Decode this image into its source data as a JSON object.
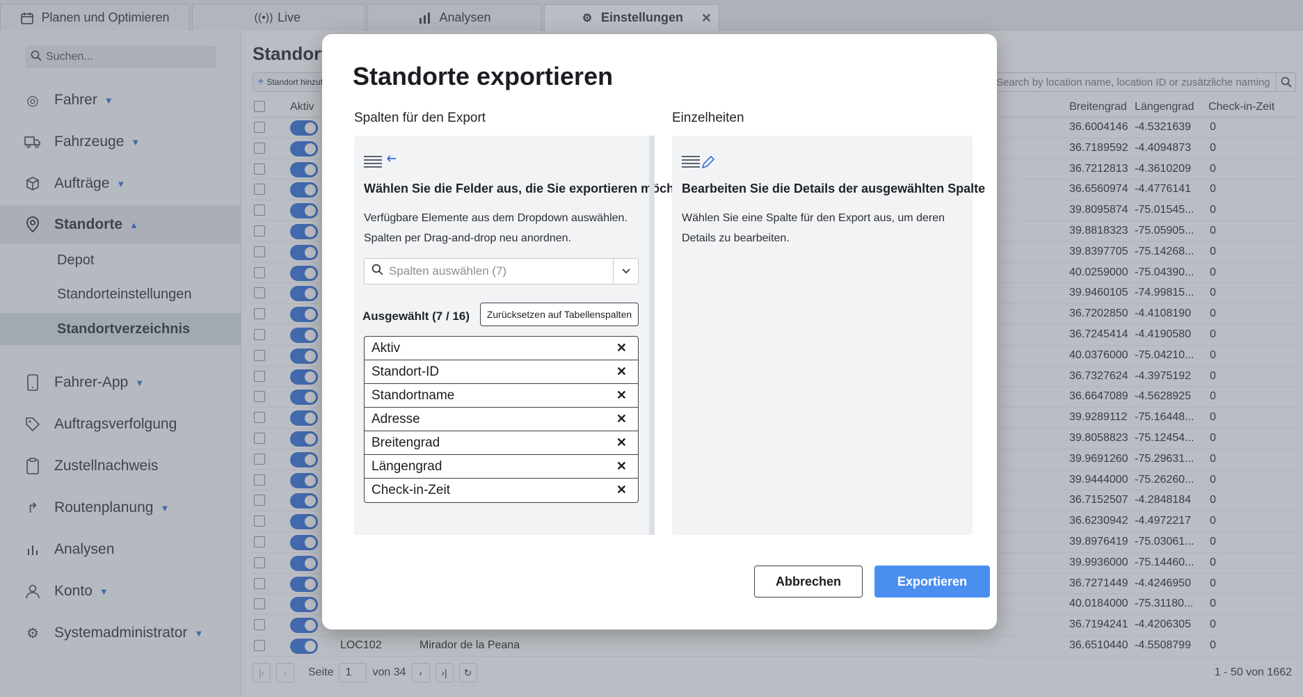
{
  "tabs": [
    {
      "label": "Planen und Optimieren",
      "icon": "calendar-icon"
    },
    {
      "label": "Live",
      "icon": "broadcast-icon"
    },
    {
      "label": "Analysen",
      "icon": "bar-chart-icon"
    },
    {
      "label": "Einstellungen",
      "icon": "gear-icon",
      "active": true
    }
  ],
  "sidebar": {
    "search_placeholder": "Suchen...",
    "items": [
      {
        "label": "Fahrer",
        "icon": "steering-wheel-icon"
      },
      {
        "label": "Fahrzeuge",
        "icon": "truck-icon"
      },
      {
        "label": "Aufträge",
        "icon": "package-icon"
      },
      {
        "label": "Standorte",
        "icon": "location-pin-icon"
      },
      {
        "label": "Fahrer-App",
        "icon": "mobile-icon"
      },
      {
        "label": "Auftragsverfolgung",
        "icon": "tag-icon"
      },
      {
        "label": "Zustellnachweis",
        "icon": "clipboard-icon"
      },
      {
        "label": "Routenplanung",
        "icon": "route-arrow-icon"
      },
      {
        "label": "Analysen",
        "icon": "bar-chart-icon"
      },
      {
        "label": "Konto",
        "icon": "user-icon"
      },
      {
        "label": "Systemadministrator",
        "icon": "gear-icon"
      }
    ],
    "subitems": [
      "Depot",
      "Standorteinstellungen",
      "Standortverzeichnis"
    ]
  },
  "main": {
    "title": "Standort",
    "add_button": "Standort hinzufügen",
    "table_search_placeholder": "Search by location name, location ID or zusätzliche naming",
    "columns": {
      "active": "Aktiv",
      "lat": "Breitengrad",
      "lng": "Längengrad",
      "checkin": "Check-in-Zeit"
    },
    "rows": [
      {
        "lat": "36.6004146",
        "lng": "-4.5321639",
        "checkin": "0"
      },
      {
        "lat": "36.7189592",
        "lng": "-4.4094873",
        "checkin": "0"
      },
      {
        "lat": "36.7212813",
        "lng": "-4.3610209",
        "checkin": "0"
      },
      {
        "lat": "36.6560974",
        "lng": "-4.4776141",
        "checkin": "0"
      },
      {
        "lat": "39.8095874",
        "lng": "-75.01545...",
        "checkin": "0"
      },
      {
        "lat": "39.8818323",
        "lng": "-75.05905...",
        "checkin": "0"
      },
      {
        "lat": "39.8397705",
        "lng": "-75.14268...",
        "checkin": "0"
      },
      {
        "lat": "40.0259000",
        "lng": "-75.04390...",
        "checkin": "0"
      },
      {
        "lat": "39.9460105",
        "lng": "-74.99815...",
        "checkin": "0"
      },
      {
        "lat": "36.7202850",
        "lng": "-4.4108190",
        "checkin": "0"
      },
      {
        "lat": "36.7245414",
        "lng": "-4.4190580",
        "checkin": "0"
      },
      {
        "lat": "40.0376000",
        "lng": "-75.04210...",
        "checkin": "0"
      },
      {
        "lat": "36.7327624",
        "lng": "-4.3975192",
        "checkin": "0"
      },
      {
        "lat": "36.6647089",
        "lng": "-4.5628925",
        "checkin": "0"
      },
      {
        "lat": "39.9289112",
        "lng": "-75.16448...",
        "checkin": "0"
      },
      {
        "lat": "39.8058823",
        "lng": "-75.12454...",
        "checkin": "0"
      },
      {
        "lat": "39.9691260",
        "lng": "-75.29631...",
        "checkin": "0"
      },
      {
        "lat": "39.9444000",
        "lng": "-75.26260...",
        "checkin": "0"
      },
      {
        "lat": "36.7152507",
        "lng": "-4.2848184",
        "checkin": "0"
      },
      {
        "lat": "36.6230942",
        "lng": "-4.4972217",
        "checkin": "0"
      },
      {
        "lat": "39.8976419",
        "lng": "-75.03061...",
        "checkin": "0"
      },
      {
        "lat": "39.9936000",
        "lng": "-75.14460...",
        "checkin": "0"
      },
      {
        "lat": "36.7271449",
        "lng": "-4.4246950",
        "checkin": "0"
      },
      {
        "lat": "40.0184000",
        "lng": "-75.31180...",
        "checkin": "0"
      },
      {
        "lat": "36.7194241",
        "lng": "-4.4206305",
        "checkin": "0"
      },
      {
        "id": "LOC102",
        "name": "Mirador de la Peana",
        "lat": "36.6510440",
        "lng": "-4.5508799",
        "checkin": "0"
      }
    ],
    "pager": {
      "page_label": "Seite",
      "page": "1",
      "of_label": "von 34",
      "range": "1 - 50 von 1662"
    }
  },
  "modal": {
    "title": "Standorte exportieren",
    "left_title": "Spalten für den Export",
    "right_title": "Einzelheiten",
    "left_head": "Wählen Sie die Felder aus, die Sie exportieren möchten",
    "left_text": "Verfügbare Elemente aus dem Dropdown auswählen. Spalten per Drag-and-drop neu anordnen.",
    "select_placeholder": "Spalten auswählen (7)",
    "selected_label": "Ausgewählt (7 / 16)",
    "reset_label": "Zurücksetzen auf Tabellenspalten",
    "selected": [
      "Aktiv",
      "Standort-ID",
      "Standortname",
      "Adresse",
      "Breitengrad",
      "Längengrad",
      "Check-in-Zeit"
    ],
    "right_head": "Bearbeiten Sie die Details der ausgewählten Spalte",
    "right_text": "Wählen Sie eine Spalte für den Export aus, um deren Details zu bearbeiten.",
    "cancel_label": "Abbrechen",
    "export_label": "Exportieren"
  },
  "colors": {
    "accent": "#2f6fd6",
    "export_button": "#4a8ff0"
  }
}
